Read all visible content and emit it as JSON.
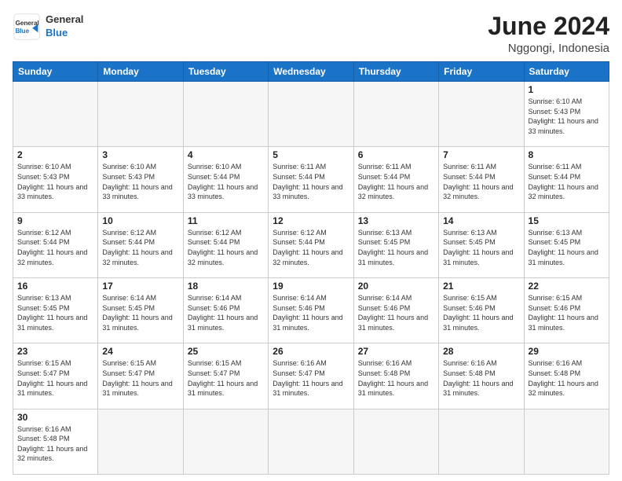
{
  "logo": {
    "general": "General",
    "blue": "Blue"
  },
  "title": "June 2024",
  "subtitle": "Nggongi, Indonesia",
  "days_of_week": [
    "Sunday",
    "Monday",
    "Tuesday",
    "Wednesday",
    "Thursday",
    "Friday",
    "Saturday"
  ],
  "weeks": [
    [
      {
        "day": "",
        "info": ""
      },
      {
        "day": "",
        "info": ""
      },
      {
        "day": "",
        "info": ""
      },
      {
        "day": "",
        "info": ""
      },
      {
        "day": "",
        "info": ""
      },
      {
        "day": "",
        "info": ""
      },
      {
        "day": "1",
        "info": "Sunrise: 6:10 AM\nSunset: 5:43 PM\nDaylight: 11 hours\nand 33 minutes."
      }
    ],
    [
      {
        "day": "2",
        "info": "Sunrise: 6:10 AM\nSunset: 5:43 PM\nDaylight: 11 hours\nand 33 minutes."
      },
      {
        "day": "3",
        "info": "Sunrise: 6:10 AM\nSunset: 5:43 PM\nDaylight: 11 hours\nand 33 minutes."
      },
      {
        "day": "4",
        "info": "Sunrise: 6:10 AM\nSunset: 5:44 PM\nDaylight: 11 hours\nand 33 minutes."
      },
      {
        "day": "5",
        "info": "Sunrise: 6:11 AM\nSunset: 5:44 PM\nDaylight: 11 hours\nand 33 minutes."
      },
      {
        "day": "6",
        "info": "Sunrise: 6:11 AM\nSunset: 5:44 PM\nDaylight: 11 hours\nand 32 minutes."
      },
      {
        "day": "7",
        "info": "Sunrise: 6:11 AM\nSunset: 5:44 PM\nDaylight: 11 hours\nand 32 minutes."
      },
      {
        "day": "8",
        "info": "Sunrise: 6:11 AM\nSunset: 5:44 PM\nDaylight: 11 hours\nand 32 minutes."
      }
    ],
    [
      {
        "day": "9",
        "info": "Sunrise: 6:12 AM\nSunset: 5:44 PM\nDaylight: 11 hours\nand 32 minutes."
      },
      {
        "day": "10",
        "info": "Sunrise: 6:12 AM\nSunset: 5:44 PM\nDaylight: 11 hours\nand 32 minutes."
      },
      {
        "day": "11",
        "info": "Sunrise: 6:12 AM\nSunset: 5:44 PM\nDaylight: 11 hours\nand 32 minutes."
      },
      {
        "day": "12",
        "info": "Sunrise: 6:12 AM\nSunset: 5:44 PM\nDaylight: 11 hours\nand 32 minutes."
      },
      {
        "day": "13",
        "info": "Sunrise: 6:13 AM\nSunset: 5:45 PM\nDaylight: 11 hours\nand 31 minutes."
      },
      {
        "day": "14",
        "info": "Sunrise: 6:13 AM\nSunset: 5:45 PM\nDaylight: 11 hours\nand 31 minutes."
      },
      {
        "day": "15",
        "info": "Sunrise: 6:13 AM\nSunset: 5:45 PM\nDaylight: 11 hours\nand 31 minutes."
      }
    ],
    [
      {
        "day": "16",
        "info": "Sunrise: 6:13 AM\nSunset: 5:45 PM\nDaylight: 11 hours\nand 31 minutes."
      },
      {
        "day": "17",
        "info": "Sunrise: 6:14 AM\nSunset: 5:45 PM\nDaylight: 11 hours\nand 31 minutes."
      },
      {
        "day": "18",
        "info": "Sunrise: 6:14 AM\nSunset: 5:46 PM\nDaylight: 11 hours\nand 31 minutes."
      },
      {
        "day": "19",
        "info": "Sunrise: 6:14 AM\nSunset: 5:46 PM\nDaylight: 11 hours\nand 31 minutes."
      },
      {
        "day": "20",
        "info": "Sunrise: 6:14 AM\nSunset: 5:46 PM\nDaylight: 11 hours\nand 31 minutes."
      },
      {
        "day": "21",
        "info": "Sunrise: 6:15 AM\nSunset: 5:46 PM\nDaylight: 11 hours\nand 31 minutes."
      },
      {
        "day": "22",
        "info": "Sunrise: 6:15 AM\nSunset: 5:46 PM\nDaylight: 11 hours\nand 31 minutes."
      }
    ],
    [
      {
        "day": "23",
        "info": "Sunrise: 6:15 AM\nSunset: 5:47 PM\nDaylight: 11 hours\nand 31 minutes."
      },
      {
        "day": "24",
        "info": "Sunrise: 6:15 AM\nSunset: 5:47 PM\nDaylight: 11 hours\nand 31 minutes."
      },
      {
        "day": "25",
        "info": "Sunrise: 6:15 AM\nSunset: 5:47 PM\nDaylight: 11 hours\nand 31 minutes."
      },
      {
        "day": "26",
        "info": "Sunrise: 6:16 AM\nSunset: 5:47 PM\nDaylight: 11 hours\nand 31 minutes."
      },
      {
        "day": "27",
        "info": "Sunrise: 6:16 AM\nSunset: 5:48 PM\nDaylight: 11 hours\nand 31 minutes."
      },
      {
        "day": "28",
        "info": "Sunrise: 6:16 AM\nSunset: 5:48 PM\nDaylight: 11 hours\nand 31 minutes."
      },
      {
        "day": "29",
        "info": "Sunrise: 6:16 AM\nSunset: 5:48 PM\nDaylight: 11 hours\nand 32 minutes."
      }
    ],
    [
      {
        "day": "30",
        "info": "Sunrise: 6:16 AM\nSunset: 5:48 PM\nDaylight: 11 hours\nand 32 minutes."
      },
      {
        "day": "",
        "info": ""
      },
      {
        "day": "",
        "info": ""
      },
      {
        "day": "",
        "info": ""
      },
      {
        "day": "",
        "info": ""
      },
      {
        "day": "",
        "info": ""
      },
      {
        "day": "",
        "info": ""
      }
    ]
  ]
}
